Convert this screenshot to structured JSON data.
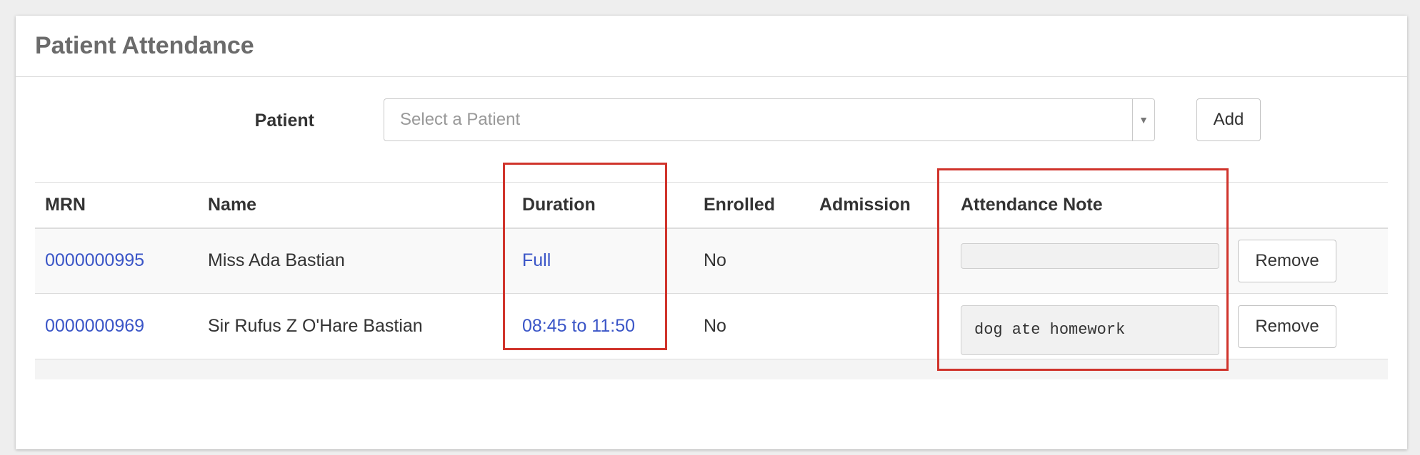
{
  "panel": {
    "title": "Patient Attendance"
  },
  "form": {
    "patient_label": "Patient",
    "select_placeholder": "Select a Patient",
    "add_label": "Add"
  },
  "table": {
    "headers": {
      "mrn": "MRN",
      "name": "Name",
      "duration": "Duration",
      "enrolled": "Enrolled",
      "admission": "Admission",
      "note": "Attendance Note"
    },
    "rows": [
      {
        "mrn": "0000000995",
        "name": "Miss Ada Bastian",
        "duration": "Full",
        "enrolled": "No",
        "admission": "",
        "note": "",
        "remove_label": "Remove"
      },
      {
        "mrn": "0000000969",
        "name": "Sir Rufus Z O'Hare Bastian",
        "duration": "08:45 to 11:50",
        "enrolled": "No",
        "admission": "",
        "note": "dog ate homework",
        "remove_label": "Remove"
      }
    ]
  },
  "colors": {
    "link": "#3a55c7",
    "highlight": "#d0342c",
    "title": "#6b6b6b"
  },
  "icons": {
    "select_arrow": "caret-down-icon"
  }
}
